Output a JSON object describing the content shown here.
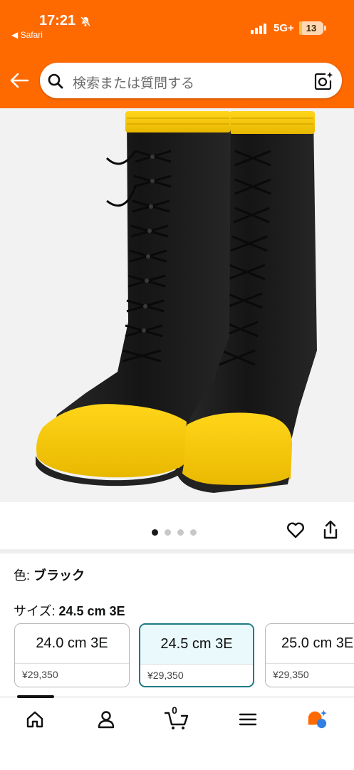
{
  "status_bar": {
    "time": "17:21",
    "back_app": "◀ Safari",
    "network": "5G+",
    "battery": "13",
    "battery_level": 0.13
  },
  "search": {
    "placeholder": "検索または質問する"
  },
  "carousel": {
    "total": 4,
    "active_index": 0
  },
  "variations": {
    "color_label": "色: ",
    "color_value": "ブラック",
    "size_label": "サイズ: ",
    "size_value": "24.5 cm 3E",
    "options": [
      {
        "size": "24.0 cm 3E",
        "price": "¥29,350",
        "selected": false
      },
      {
        "size": "24.5 cm 3E",
        "price": "¥29,350",
        "selected": true
      },
      {
        "size": "25.0 cm 3E",
        "price": "¥29,350",
        "selected": false
      }
    ]
  },
  "nav": {
    "cart_count": "0",
    "items": [
      "home-icon",
      "account-icon",
      "cart-icon",
      "menu-icon",
      "ai-assistant-icon"
    ]
  },
  "colors": {
    "header": "#ff6a00",
    "selected_border": "#1f7a87",
    "boot_yellow": "#f5c400",
    "boot_black": "#1b1b1b"
  }
}
